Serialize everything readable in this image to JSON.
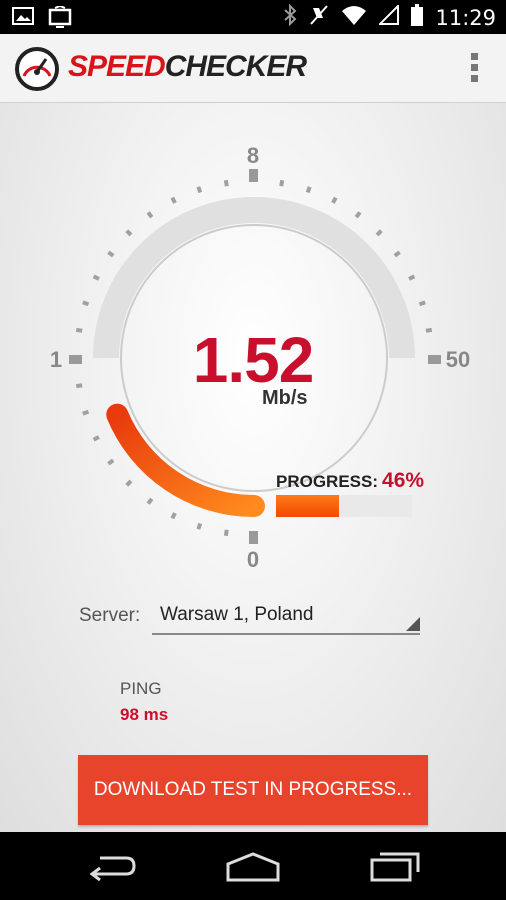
{
  "status_bar": {
    "time": "11:29",
    "icons": [
      "image-icon",
      "cast-icon",
      "bluetooth-icon",
      "mute-icon",
      "wifi-icon",
      "signal-icon",
      "battery-icon"
    ]
  },
  "app_bar": {
    "logo_speed": "SPEED",
    "logo_checker": "CHECKER",
    "menu_icon": "overflow-menu-icon"
  },
  "gauge": {
    "tick_labels": {
      "top": "8",
      "left": "1",
      "right": "50",
      "bottom": "0"
    },
    "speed_value": "1.52",
    "speed_unit": "Mb/s",
    "speed_level": 0.25,
    "accent_color": "#f26a12"
  },
  "progress": {
    "label": "PROGRESS:",
    "value_text": "46%",
    "value": 0.46
  },
  "server": {
    "label": "Server:",
    "selected": "Warsaw 1, Poland"
  },
  "ping": {
    "label": "PING",
    "value": "98 ms"
  },
  "action_button": {
    "label": "DOWNLOAD TEST IN PROGRESS..."
  },
  "colors": {
    "brand_red": "#c8102e",
    "button": "#e8442c"
  },
  "nav_bar": {
    "icons": [
      "back-icon",
      "home-icon",
      "recents-icon"
    ]
  }
}
